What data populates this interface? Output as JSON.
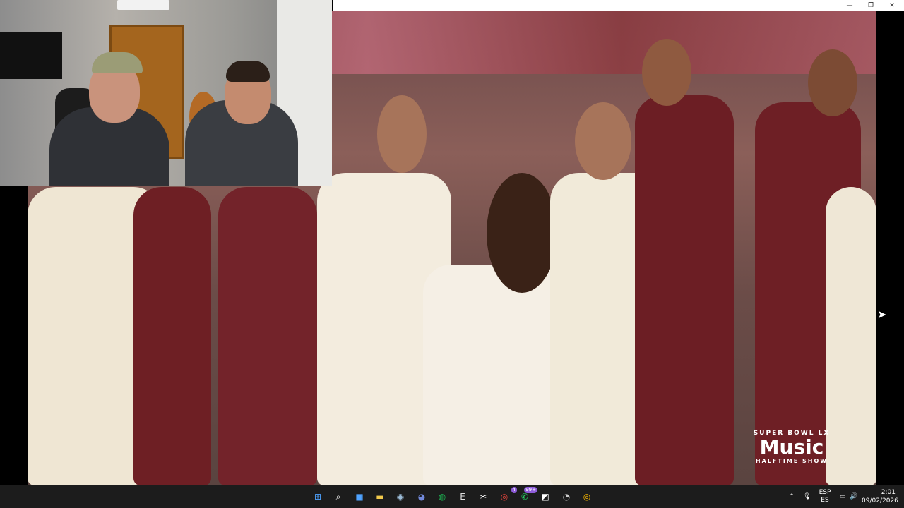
{
  "titlebar": {
    "minimize_glyph": "—",
    "maximize_glyph": "❐",
    "close_glyph": "✕"
  },
  "video": {
    "badge_top": "SUPER BOWL LX",
    "badge_brand": "Music",
    "badge_bottom": "HALFTIME SHOW",
    "apple_glyph": ""
  },
  "taskbar": {
    "icons": [
      {
        "name": "windows-start-icon",
        "glyph": "⊞",
        "color": "#4fa3ff"
      },
      {
        "name": "search-icon",
        "glyph": "⌕",
        "color": "#ffffff"
      },
      {
        "name": "store-icon",
        "glyph": "▣",
        "color": "#4fa3ff"
      },
      {
        "name": "file-explorer-icon",
        "glyph": "▬",
        "color": "#f2c94c"
      },
      {
        "name": "steam-icon",
        "glyph": "◉",
        "color": "#9bbbd6"
      },
      {
        "name": "discord-icon",
        "glyph": "◕",
        "color": "#7289da"
      },
      {
        "name": "spotify-icon",
        "glyph": "◍",
        "color": "#1db954"
      },
      {
        "name": "epic-games-icon",
        "glyph": "E",
        "color": "#dddddd"
      },
      {
        "name": "capcut-icon",
        "glyph": "✂",
        "color": "#ffffff"
      },
      {
        "name": "chrome-icon",
        "glyph": "◎",
        "color": "#e8453c"
      },
      {
        "name": "whatsapp-icon",
        "glyph": "✆",
        "color": "#25d366"
      },
      {
        "name": "snipping-tool-icon",
        "glyph": "◩",
        "color": "#ffffff"
      },
      {
        "name": "obs-icon",
        "glyph": "◔",
        "color": "#cccccc"
      },
      {
        "name": "chrome-dev-icon",
        "glyph": "◎",
        "color": "#f4b400"
      }
    ],
    "badges": {
      "chrome": "4",
      "whatsapp": "99+"
    },
    "tray": {
      "chevron": "^",
      "mic_glyph": "🎙",
      "lang_top": "ESP",
      "lang_bottom": "ES",
      "display_glyph": "▭",
      "speaker_glyph": "🔊"
    },
    "clock": {
      "time": "2:01",
      "date": "09/02/2026"
    }
  }
}
